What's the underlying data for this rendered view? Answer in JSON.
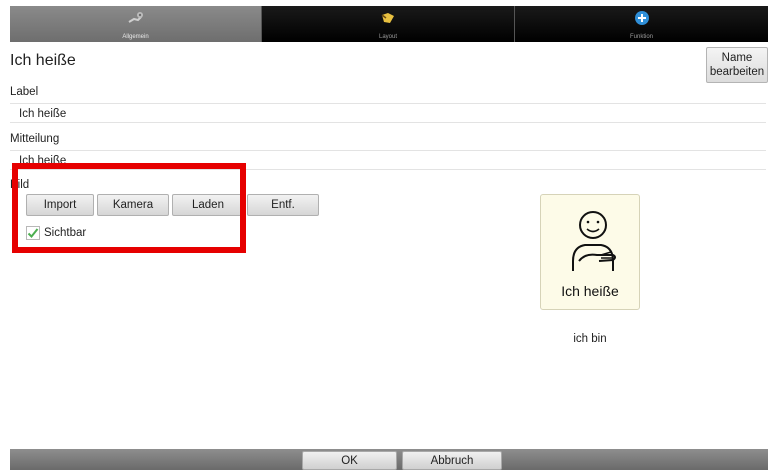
{
  "tabs": [
    {
      "label": "Allgemein",
      "icon": "settings-hand-icon",
      "active": true
    },
    {
      "label": "Layout",
      "icon": "layout-icon",
      "active": false
    },
    {
      "label": "Funktion",
      "icon": "plus-circle-icon",
      "active": false
    }
  ],
  "header": {
    "title": "Ich heiße",
    "name_edit_label_line1": "Name",
    "name_edit_label_line2": "bearbeiten"
  },
  "fields": {
    "label_caption": "Label",
    "label_value": "Ich heiße",
    "message_caption": "Mitteilung",
    "message_value": "Ich heiße"
  },
  "image_section": {
    "caption": "Bild",
    "buttons": [
      "Import",
      "Kamera",
      "Laden",
      "Entf."
    ],
    "visible_label": "Sichtbar",
    "visible_checked": true
  },
  "symbol": {
    "label": "Ich heiße",
    "message": "ich bin"
  },
  "footer": {
    "ok_label": "OK",
    "cancel_label": "Abbruch"
  },
  "colors": {
    "highlight": "#e60000",
    "checkmark": "#4caf50",
    "tab_active": "#7a7a7a",
    "tab_inactive": "#000000",
    "plus_icon": "#2f8fd8",
    "layout_icon": "#e8c040"
  }
}
